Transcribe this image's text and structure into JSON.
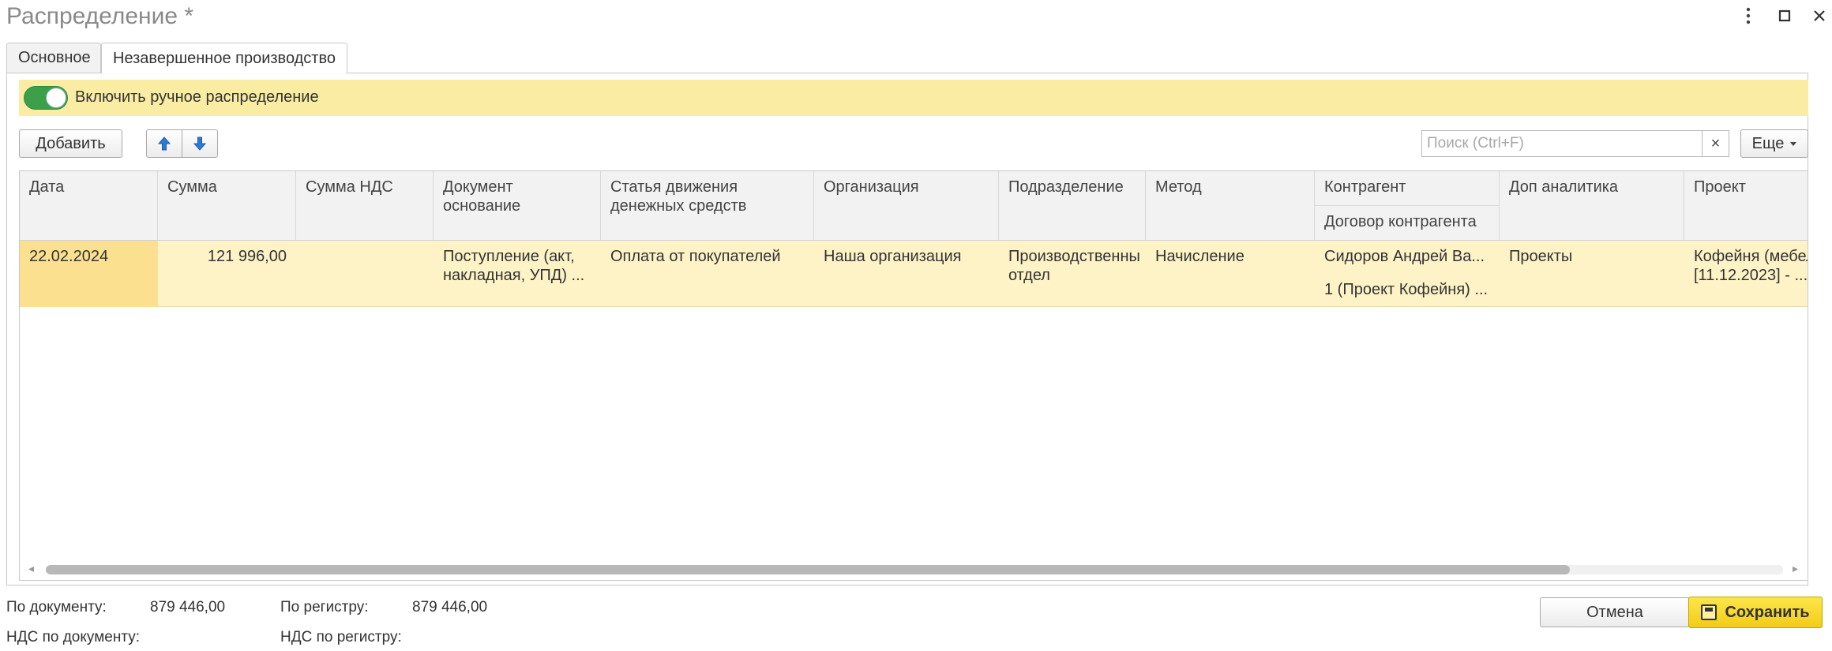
{
  "window": {
    "title": "Распределение *",
    "more_icon": "⋮",
    "maximize_icon": "☐",
    "close_icon": "✕"
  },
  "tabs": [
    {
      "label": "Основное"
    },
    {
      "label": "Незавершенное производство"
    }
  ],
  "manual": {
    "label": "Включить ручное распределение",
    "enabled": true
  },
  "toolbar": {
    "add_label": "Добавить",
    "up_icon": "🡅",
    "down_icon": "🡇",
    "search_placeholder": "Поиск (Ctrl+F)",
    "clear_icon": "×",
    "more_label": "Еще"
  },
  "table": {
    "headers": {
      "date": "Дата",
      "sum": "Сумма",
      "vat": "Сумма НДС",
      "doc": "Документ\nоснование",
      "cashflow": "Статья движения\nденежных средств",
      "org": "Организация",
      "dept": "Подразделение",
      "method": "Метод",
      "counterparty": "Контрагент",
      "contract": "Договор контрагента",
      "analytics": "Доп аналитика",
      "project": "Проект"
    },
    "rows": [
      {
        "date": "22.02.2024",
        "sum": "121 996,00",
        "vat": "",
        "doc": "Поступление (акт,\nнакладная, УПД) ...",
        "cashflow": "Оплата от покупателей",
        "org": "Наша организация",
        "dept": "Производственны\n отдел",
        "method": "Начисление",
        "counterparty": "Сидоров Андрей Ва...",
        "contract": "1 (Проект Кофейня) ...",
        "analytics": "Проекты",
        "project": "Кофейня (мебел\n[11.12.2023] - ..."
      }
    ]
  },
  "footer": {
    "by_doc_label": "По документу:",
    "by_doc_value": "879 446,00",
    "by_reg_label": "По регистру:",
    "by_reg_value": "879 446,00",
    "vat_doc_label": "НДС по документу:",
    "vat_reg_label": "НДС по регистру:",
    "cancel_label": "Отмена",
    "save_label": "Сохранить"
  },
  "colors": {
    "accent_yellow": "#fbeca3",
    "toggle_on": "#3c9f4a",
    "save_button": "#f2cc17",
    "selected_row": "#fdf3c6"
  }
}
